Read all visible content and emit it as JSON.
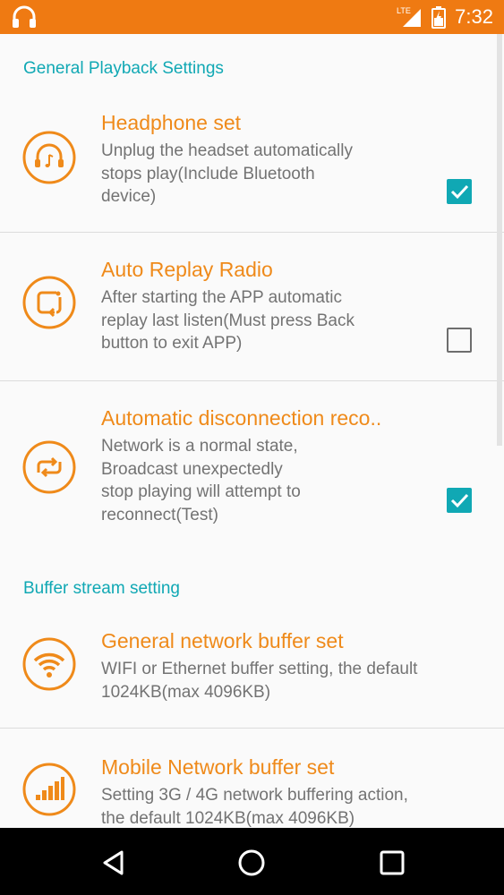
{
  "status_bar": {
    "time": "7:32",
    "network": "LTE",
    "app_icon": "headphones-icon"
  },
  "sections": [
    {
      "header": "General Playback Settings",
      "items": [
        {
          "title": "Headphone set",
          "summary_lines": [
            "Unplug the headset automatically",
            "stops play(Include Bluetooth",
            "device)"
          ],
          "checked": true,
          "icon": "headphone-music-icon"
        },
        {
          "title": "Auto Replay Radio",
          "summary_lines": [
            "After starting the APP automatic",
            "replay last listen(Must press Back",
            "button to exit APP)"
          ],
          "checked": false,
          "icon": "auto-replay-icon"
        },
        {
          "title": "Automatic disconnection reco..",
          "summary_lines": [
            "Network is a normal state,",
            "Broadcast unexpectedly",
            "stop playing will attempt to",
            "reconnect(Test)"
          ],
          "checked": true,
          "icon": "reconnect-icon"
        }
      ]
    },
    {
      "header": "Buffer stream setting",
      "items": [
        {
          "title": "General network buffer set",
          "summary_lines": [
            "WIFI or Ethernet buffer setting, the default",
            "1024KB(max 4096KB)"
          ],
          "icon": "wifi-icon"
        },
        {
          "title": "Mobile Network buffer set",
          "summary_lines": [
            "Setting 3G / 4G network buffering action,",
            "the default 1024KB(max 4096KB)"
          ],
          "icon": "signal-bars-icon"
        }
      ]
    }
  ],
  "nav_bar": {
    "back": "back-icon",
    "home": "home-icon",
    "recents": "recents-icon"
  },
  "colors": {
    "status_bar": "#ef7a12",
    "accent_orange": "#ef8a1a",
    "accent_teal": "#10a8b4",
    "summary_text": "#737373"
  }
}
